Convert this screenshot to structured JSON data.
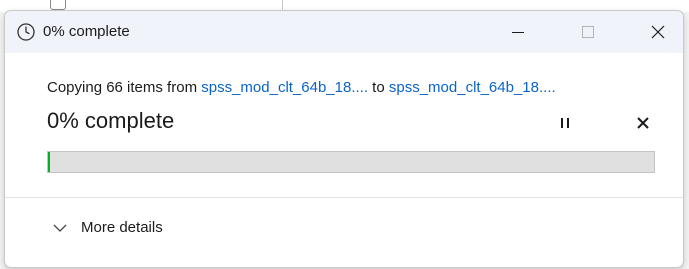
{
  "window": {
    "title": "0% complete",
    "icons": {
      "title": "clock-icon",
      "minimize": "minimize-icon",
      "maximize": "maximize-icon",
      "close": "close-icon"
    }
  },
  "copy": {
    "prefix": "Copying 66 items from ",
    "source": "spss_mod_clt_64b_18....",
    "middle": " to ",
    "destination": "spss_mod_clt_64b_18...."
  },
  "progress": {
    "title": "0% complete",
    "percent": 0,
    "fill_color": "#06b025",
    "controls": {
      "pause_icon": "pause-icon",
      "cancel_icon": "cancel-icon"
    }
  },
  "footer": {
    "more_details_label": "More details",
    "toggle_icon": "chevron-down-icon"
  }
}
